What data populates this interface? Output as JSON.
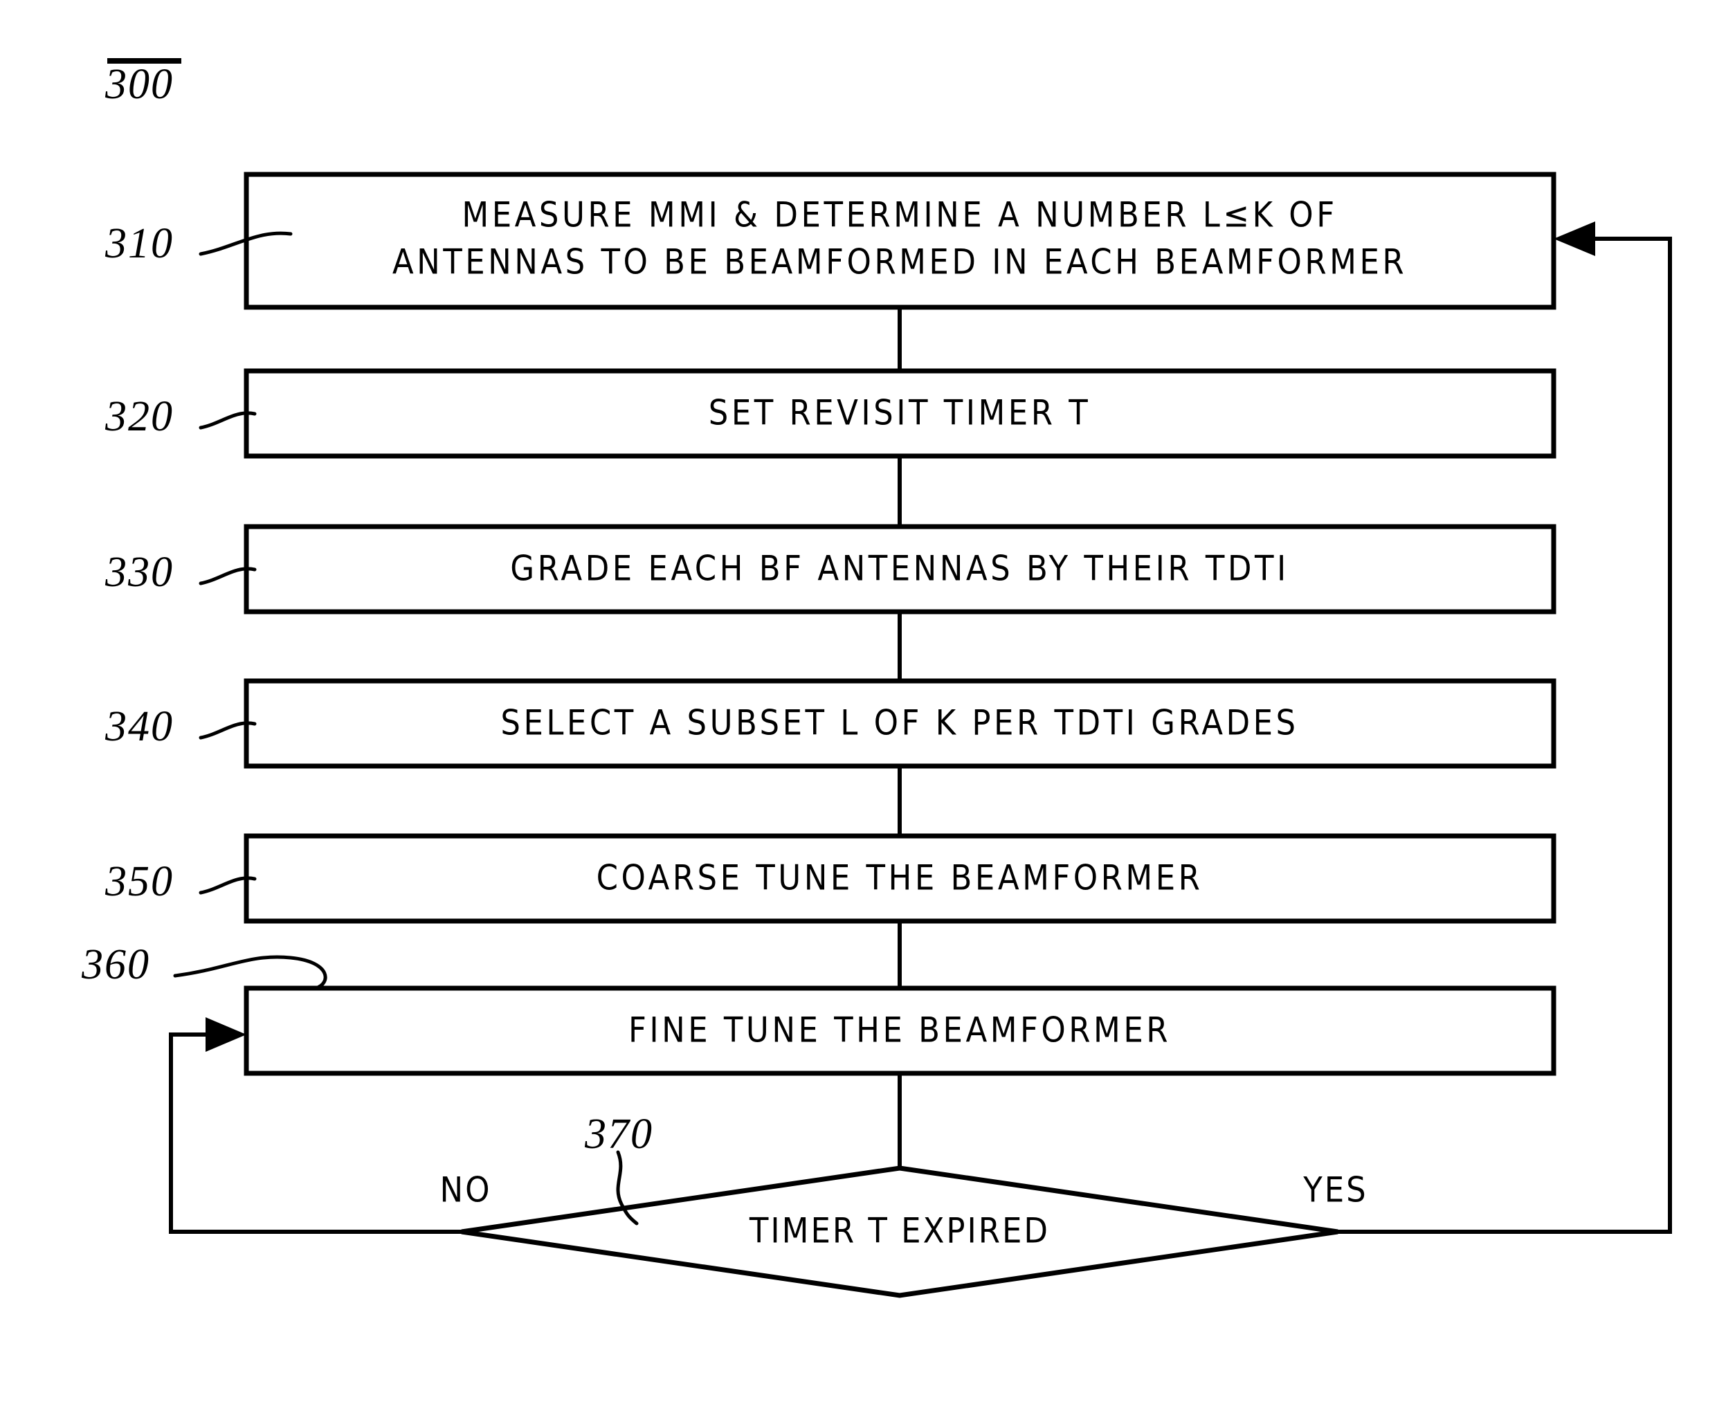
{
  "figure": {
    "number": "300",
    "underline": true
  },
  "nodes": [
    {
      "ref": "310",
      "shape": "process",
      "lines": [
        "MEASURE MMI & DETERMINE A NUMBER L≤K OF",
        "ANTENNAS TO BE BEAMFORMED IN EACH BEAMFORMER"
      ]
    },
    {
      "ref": "320",
      "shape": "process",
      "lines": [
        "SET   REVISIT TIMER T"
      ]
    },
    {
      "ref": "330",
      "shape": "process",
      "lines": [
        "GRADE EACH BF ANTENNAS BY THEIR TDTI"
      ]
    },
    {
      "ref": "340",
      "shape": "process",
      "lines": [
        "SELECT A SUBSET L OF K PER TDTI GRADES"
      ]
    },
    {
      "ref": "350",
      "shape": "process",
      "lines": [
        "COARSE TUNE THE BEAMFORMER"
      ]
    },
    {
      "ref": "360",
      "shape": "process",
      "lines": [
        "FINE TUNE THE BEAMFORMER"
      ]
    },
    {
      "ref": "370",
      "shape": "decision",
      "lines": [
        "TIMER T EXPIRED"
      ]
    }
  ],
  "branches": {
    "no_label": "NO",
    "yes_label": "YES"
  },
  "colors": {
    "stroke": "#000000",
    "fill": "#ffffff",
    "background": "#ffffff"
  }
}
